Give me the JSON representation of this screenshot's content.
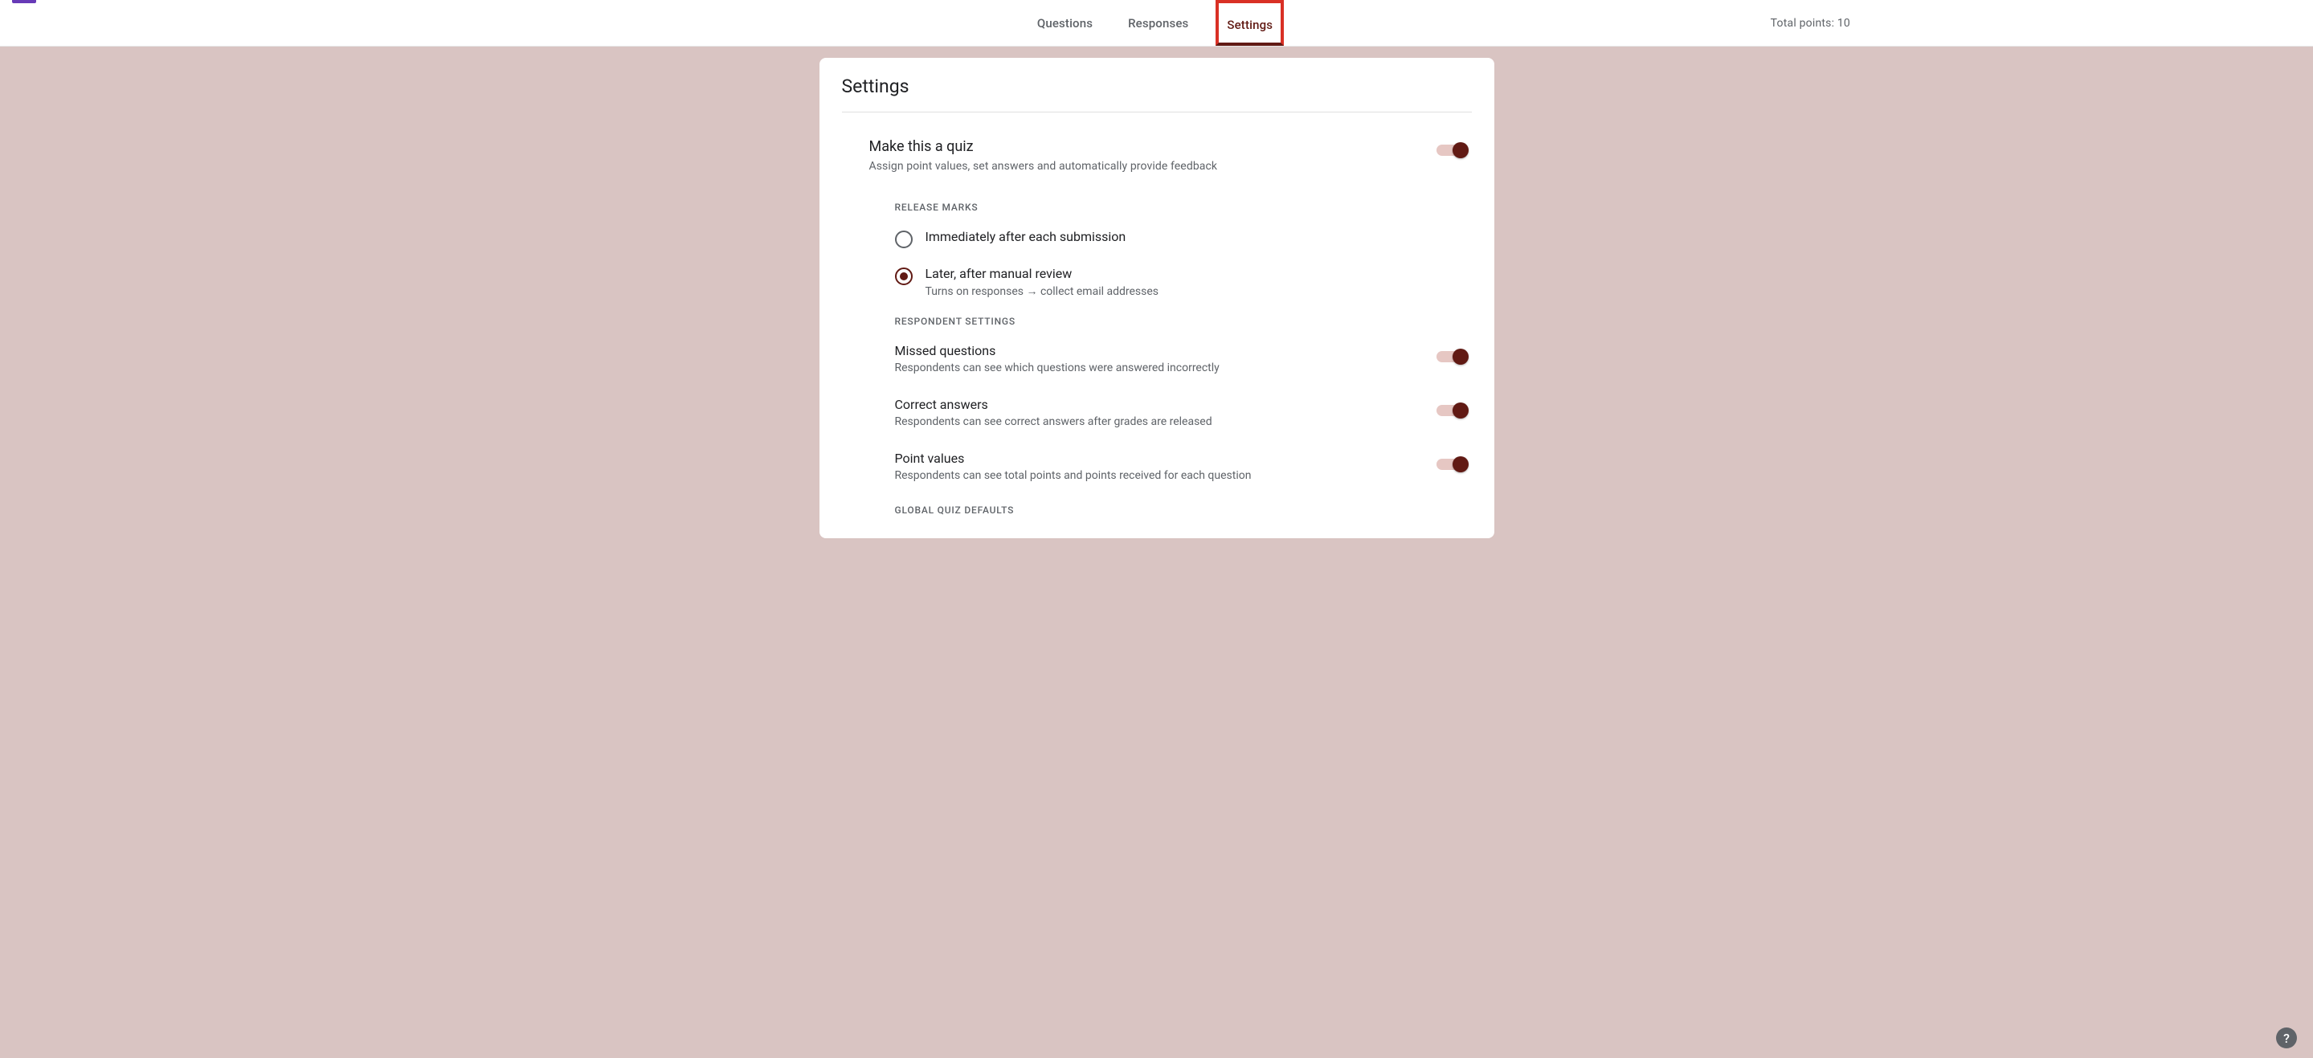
{
  "header": {
    "tabs": [
      {
        "label": "Questions"
      },
      {
        "label": "Responses"
      },
      {
        "label": "Settings"
      }
    ],
    "active_tab_index": 2,
    "total_points_label": "Total points: 10"
  },
  "card": {
    "title": "Settings",
    "quiz": {
      "title": "Make this a quiz",
      "desc": "Assign point values, set answers and automatically provide feedback",
      "enabled": true
    },
    "release_marks": {
      "heading": "RELEASE MARKS",
      "options": [
        {
          "label": "Immediately after each submission",
          "sub": "",
          "selected": false
        },
        {
          "label": "Later, after manual review",
          "sub": "Turns on responses → collect email addresses",
          "selected": true
        }
      ]
    },
    "respondent_settings": {
      "heading": "RESPONDENT SETTINGS",
      "items": [
        {
          "title": "Missed questions",
          "desc": "Respondents can see which questions were answered incorrectly",
          "enabled": true
        },
        {
          "title": "Correct answers",
          "desc": "Respondents can see correct answers after grades are released",
          "enabled": true
        },
        {
          "title": "Point values",
          "desc": "Respondents can see total points and points received for each question",
          "enabled": true
        }
      ]
    },
    "global_defaults_heading": "GLOBAL QUIZ DEFAULTS"
  },
  "help_icon": "?"
}
